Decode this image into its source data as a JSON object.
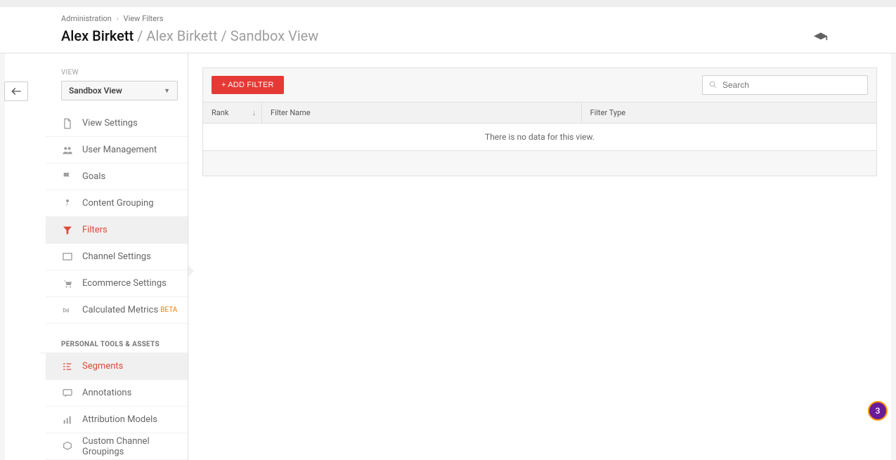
{
  "breadcrumb": {
    "root": "Administration",
    "current": "View Filters"
  },
  "title": {
    "account": "Alex Birkett",
    "property": "Alex Birkett",
    "view": "Sandbox View"
  },
  "sidebar": {
    "sectionLabel": "VIEW",
    "selector": "Sandbox View",
    "items": [
      {
        "label": "View Settings",
        "icon": "file"
      },
      {
        "label": "User Management",
        "icon": "users"
      },
      {
        "label": "Goals",
        "icon": "flag"
      },
      {
        "label": "Content Grouping",
        "icon": "person-path"
      },
      {
        "label": "Filters",
        "icon": "funnel",
        "active": true
      },
      {
        "label": "Channel Settings",
        "icon": "channel"
      },
      {
        "label": "Ecommerce Settings",
        "icon": "cart"
      },
      {
        "label": "Calculated Metrics",
        "icon": "dd",
        "tag": "BETA"
      }
    ],
    "personalHeading": "PERSONAL TOOLS & ASSETS",
    "tools": [
      {
        "label": "Segments",
        "icon": "segments",
        "active": true
      },
      {
        "label": "Annotations",
        "icon": "annotation"
      },
      {
        "label": "Attribution Models",
        "icon": "bars"
      },
      {
        "label": "Custom Channel Groupings",
        "icon": "cube"
      }
    ]
  },
  "toolbar": {
    "addFilter": "+ ADD FILTER",
    "searchPlaceholder": "Search"
  },
  "table": {
    "headers": {
      "rank": "Rank",
      "name": "Filter Name",
      "type": "Filter Type"
    },
    "emptyMessage": "There is no data for this view."
  },
  "badge": "3"
}
